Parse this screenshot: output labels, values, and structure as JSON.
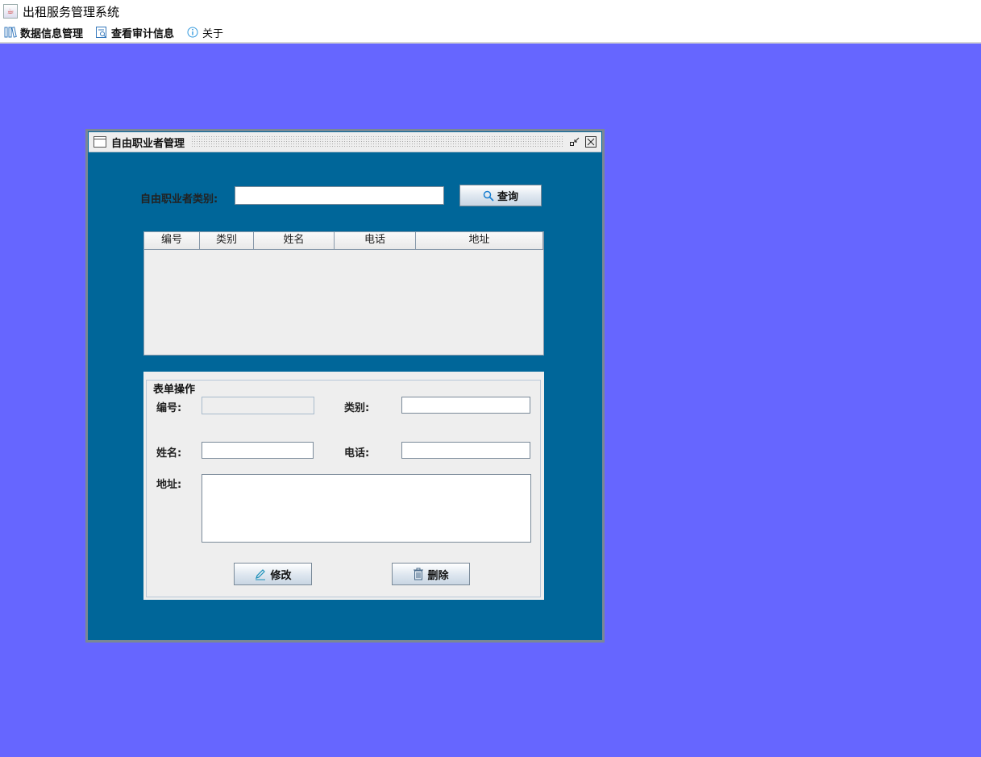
{
  "app": {
    "title": "出租服务管理系统"
  },
  "menu": {
    "items": [
      {
        "label": "数据信息管理",
        "icon": "database-icon"
      },
      {
        "label": "查看审计信息",
        "icon": "audit-icon"
      },
      {
        "label": "关于",
        "icon": "info-icon"
      }
    ]
  },
  "frame": {
    "title": "自由职业者管理"
  },
  "search": {
    "label": "自由职业者类别:",
    "value": "",
    "button_label": "查询"
  },
  "table": {
    "headers": [
      "编号",
      "类别",
      "姓名",
      "电话",
      "地址"
    ],
    "rows": []
  },
  "form": {
    "legend": "表单操作",
    "id_label": "编号:",
    "id_value": "",
    "category_label": "类别:",
    "category_value": "",
    "name_label": "姓名:",
    "name_value": "",
    "phone_label": "电话:",
    "phone_value": "",
    "address_label": "地址:",
    "address_value": "",
    "edit_label": "修改",
    "delete_label": "删除"
  },
  "colors": {
    "desktop": "#6666ff",
    "frame_content": "#006699",
    "panel": "#eeeeee"
  }
}
